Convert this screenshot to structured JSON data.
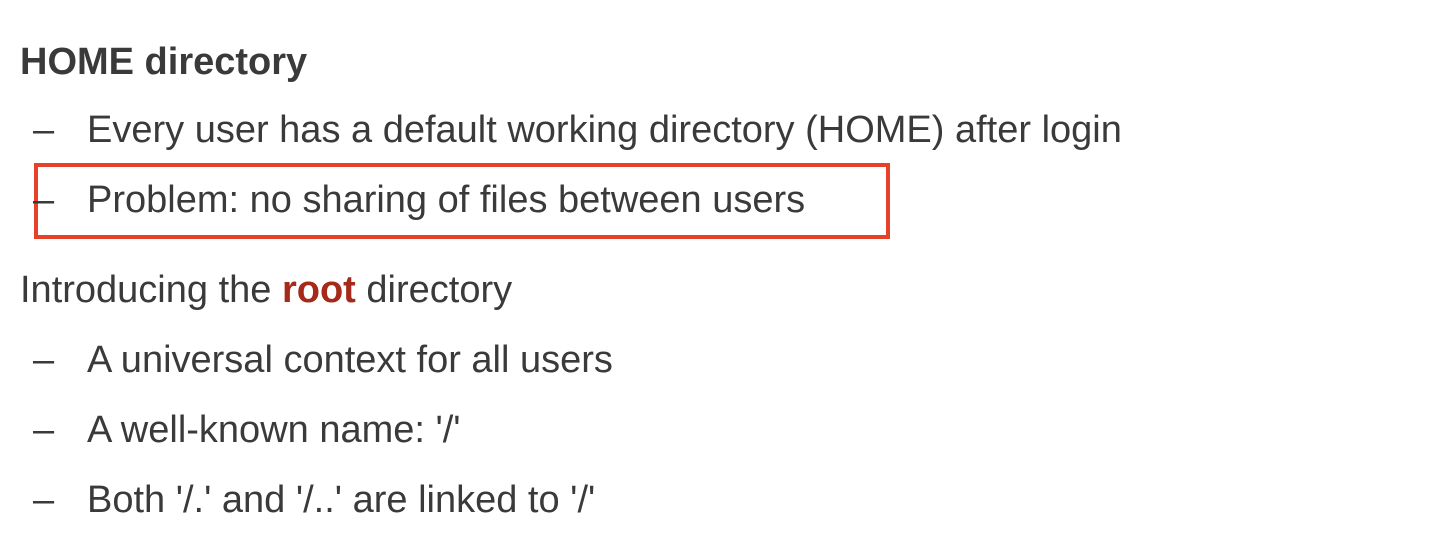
{
  "heading": "HOME directory",
  "home_items": [
    "Every user has a default working directory (HOME) after login",
    "Problem: no sharing of files between users"
  ],
  "intro": {
    "before": "Introducing the ",
    "emphasis": "root",
    "after": " directory"
  },
  "root_items": [
    "A universal context for all users",
    "A well-known name: '/'",
    "Both '/.' and '/..' are linked to '/'"
  ],
  "bullet": "–",
  "colors": {
    "text": "#3a3a3a",
    "emphasis": "#a52a1a",
    "highlight_box": "#e8412a"
  }
}
